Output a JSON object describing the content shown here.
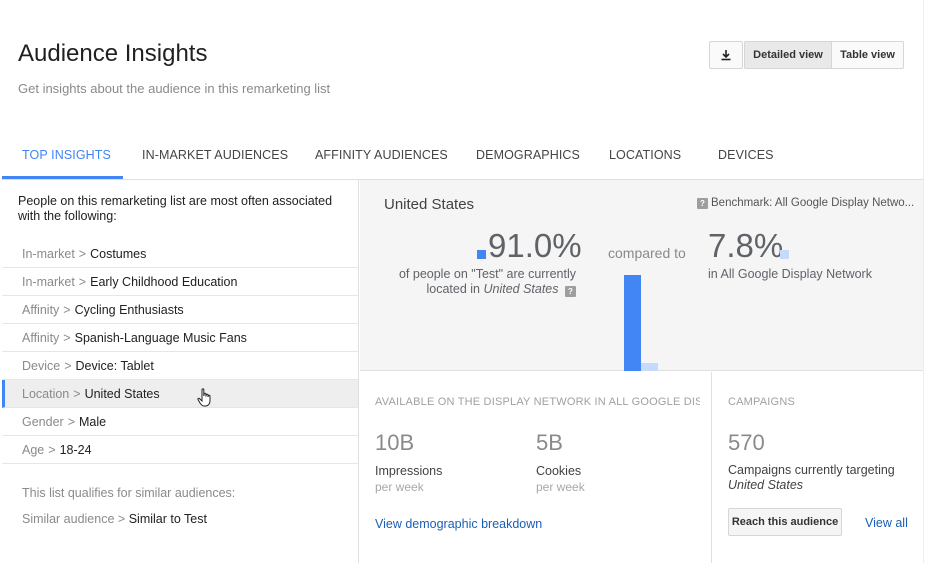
{
  "header": {
    "title": "Audience Insights",
    "subtitle": "Get insights about the audience in this remarketing list"
  },
  "toolbar": {
    "download_icon": "download-icon",
    "detailed_view": "Detailed view",
    "table_view": "Table view"
  },
  "tabs": [
    {
      "label": "TOP INSIGHTS",
      "active": true
    },
    {
      "label": "IN-MARKET AUDIENCES",
      "active": false
    },
    {
      "label": "AFFINITY AUDIENCES",
      "active": false
    },
    {
      "label": "DEMOGRAPHICS",
      "active": false
    },
    {
      "label": "LOCATIONS",
      "active": false
    },
    {
      "label": "DEVICES",
      "active": false
    }
  ],
  "left": {
    "intro": "People on this remarketing list are most often associated with the following:",
    "items": [
      {
        "category": "In-market",
        "sep": ">",
        "value": "Costumes"
      },
      {
        "category": "In-market",
        "sep": ">",
        "value": "Early Childhood Education"
      },
      {
        "category": "Affinity",
        "sep": ">",
        "value": "Cycling Enthusiasts"
      },
      {
        "category": "Affinity",
        "sep": ">",
        "value": "Spanish-Language Music Fans"
      },
      {
        "category": "Device",
        "sep": ">",
        "value": "Device: Tablet"
      },
      {
        "category": "Location",
        "sep": ">",
        "value": "United States"
      },
      {
        "category": "Gender",
        "sep": ">",
        "value": "Male"
      },
      {
        "category": "Age",
        "sep": ">",
        "value": "18-24"
      }
    ],
    "selected_index": 5,
    "similar_heading": "This list qualifies for similar audiences:",
    "similar": {
      "category": "Similar audience",
      "sep": ">",
      "value": "Similar to Test"
    }
  },
  "viz": {
    "title": "United States",
    "benchmark": "Benchmark: All Google Display Netwo...",
    "list_value": "91.0%",
    "list_desc_1": "of people on \"Test\" are currently",
    "list_desc_2a": "located in ",
    "list_desc_2b": "United States",
    "compared_to": "compared to",
    "bench_value": "7.8%",
    "bench_desc": "in All Google Display Network",
    "list_pct": 91.0,
    "bench_pct": 7.8,
    "colors": {
      "list": "#4285f4",
      "benchmark": "#c6dafc"
    }
  },
  "stats": {
    "heading": "AVAILABLE ON THE DISPLAY NETWORK IN ALL GOOGLE DIS...",
    "impressions_value": "10B",
    "impressions_label": "Impressions",
    "impressions_unit": "per week",
    "cookies_value": "5B",
    "cookies_label": "Cookies",
    "cookies_unit": "per week",
    "breakdown_link": "View demographic breakdown"
  },
  "campaigns": {
    "heading": "CAMPAIGNS",
    "value": "570",
    "desc_1": "Campaigns currently targeting",
    "desc_2": "United States",
    "reach_button": "Reach this audience",
    "view_all": "View all"
  }
}
